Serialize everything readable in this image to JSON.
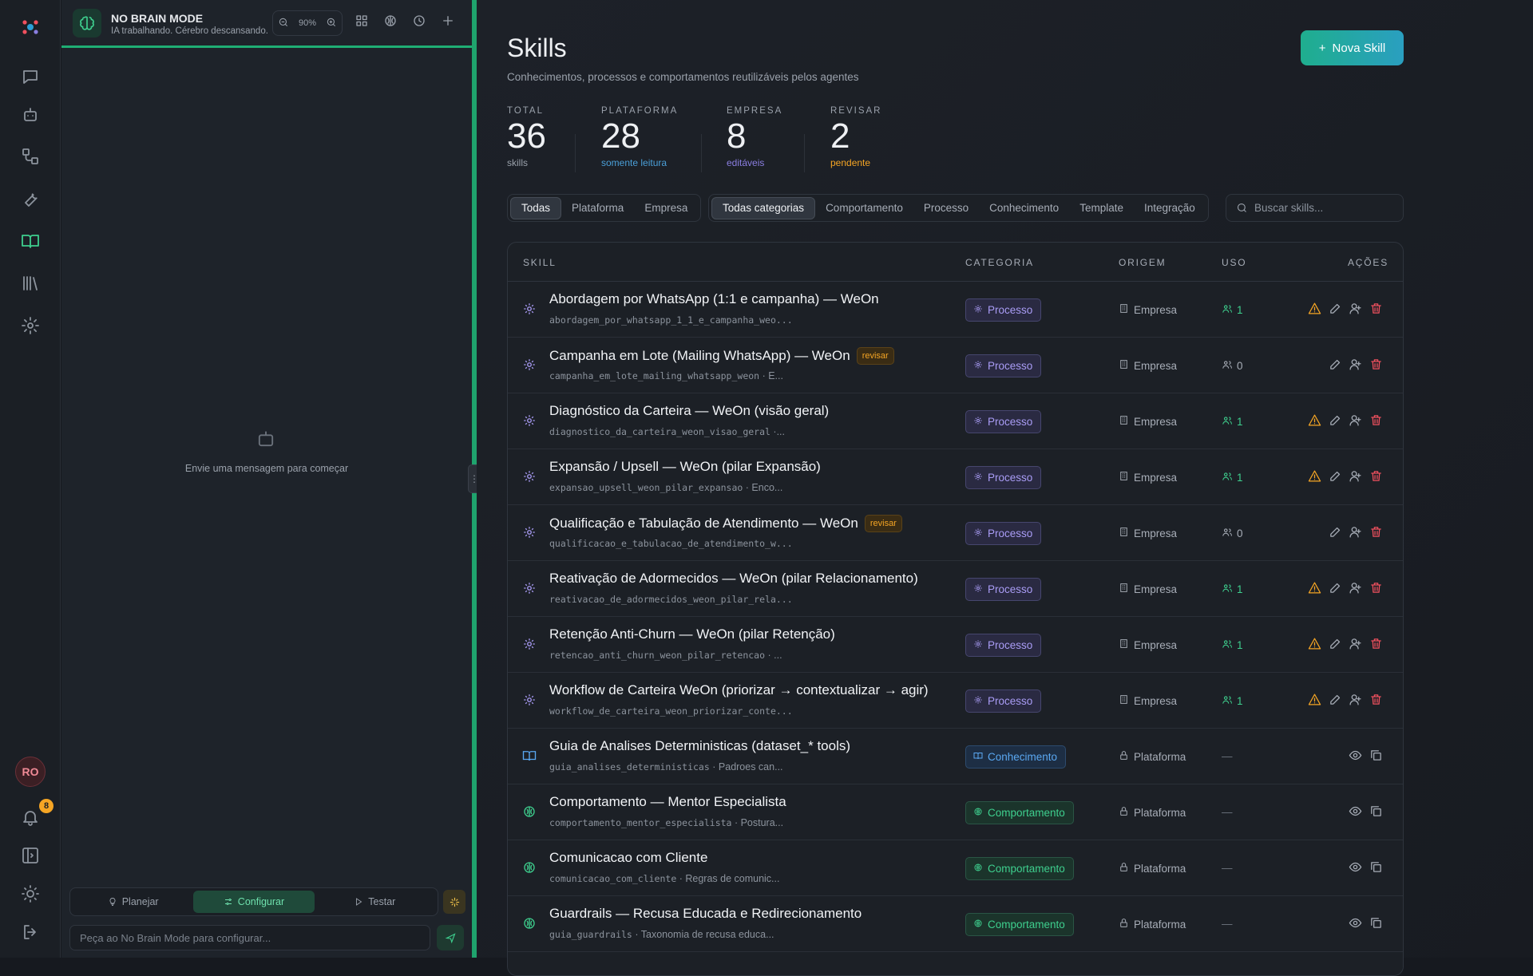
{
  "sidebar": {
    "avatar_initials": "RO",
    "notifications_count": "8",
    "icons": [
      "chat-icon",
      "bot-icon",
      "workflow-icon",
      "wrench-icon",
      "book-icon",
      "library-icon",
      "settings-icon"
    ],
    "bottom_icons": [
      "bell-icon",
      "panel-icon",
      "sun-icon",
      "logout-icon"
    ]
  },
  "chat": {
    "title": "NO BRAIN MODE",
    "subtitle": "IA trabalhando. Cérebro descansando.",
    "zoom": "90%",
    "empty_text": "Envie uma mensagem para começar",
    "modes": [
      "Planejar",
      "Configurar",
      "Testar"
    ],
    "active_mode": "Configurar",
    "input_placeholder": "Peça ao No Brain Mode para configurar..."
  },
  "page": {
    "title": "Skills",
    "subtitle": "Conhecimentos, processos e comportamentos reutilizáveis pelos agentes",
    "new_button": "Nova Skill",
    "accent": "#1fae8e"
  },
  "stats": [
    {
      "label": "TOTAL",
      "value": "36",
      "note": "skills",
      "color": "#9aa1ab"
    },
    {
      "label": "PLATAFORMA",
      "value": "28",
      "note": "somente leitura",
      "color": "#4a9fd8"
    },
    {
      "label": "EMPRESA",
      "value": "8",
      "note": "editáveis",
      "color": "#8a7ee0"
    },
    {
      "label": "REVISAR",
      "value": "2",
      "note": "pendente",
      "color": "#f5a524"
    }
  ],
  "filters": {
    "origin": [
      "Todas",
      "Plataforma",
      "Empresa"
    ],
    "origin_active": "Todas",
    "category": [
      "Todas categorias",
      "Comportamento",
      "Processo",
      "Conhecimento",
      "Template",
      "Integração"
    ],
    "category_active": "Todas categorias",
    "search_placeholder": "Buscar skills..."
  },
  "table": {
    "headers": {
      "skill": "SKILL",
      "categoria": "CATEGORIA",
      "origem": "ORIGEM",
      "uso": "USO",
      "acoes": "AÇÕES"
    },
    "rows": [
      {
        "name": "Abordagem por WhatsApp (1:1 e campanha) — WeOn",
        "slug": "abordagem_por_whatsapp_1_1_e_campanha_weo...",
        "desc": "",
        "category": "Processo",
        "origin": "Empresa",
        "uso": "1",
        "review": ""
      },
      {
        "name": "Campanha em Lote (Mailing WhatsApp) — WeOn",
        "slug": "campanha_em_lote_mailing_whatsapp_weon",
        "desc": " · E...",
        "category": "Processo",
        "origin": "Empresa",
        "uso": "0",
        "review": "revisar"
      },
      {
        "name": "Diagnóstico da Carteira — WeOn (visão geral)",
        "slug": "diagnostico_da_carteira_weon_visao_geral",
        "desc": " ·...",
        "category": "Processo",
        "origin": "Empresa",
        "uso": "1",
        "review": ""
      },
      {
        "name": "Expansão / Upsell — WeOn (pilar Expansão)",
        "slug": "expansao_upsell_weon_pilar_expansao",
        "desc": " · Enco...",
        "category": "Processo",
        "origin": "Empresa",
        "uso": "1",
        "review": ""
      },
      {
        "name": "Qualificação e Tabulação de Atendimento — WeOn",
        "slug": "qualificacao_e_tabulacao_de_atendimento_w...",
        "desc": "",
        "category": "Processo",
        "origin": "Empresa",
        "uso": "0",
        "review": "revisar"
      },
      {
        "name": "Reativação de Adormecidos — WeOn (pilar Relacionamento)",
        "slug": "reativacao_de_adormecidos_weon_pilar_rela...",
        "desc": "",
        "category": "Processo",
        "origin": "Empresa",
        "uso": "1",
        "review": ""
      },
      {
        "name": "Retenção Anti-Churn — WeOn (pilar Retenção)",
        "slug": "retencao_anti_churn_weon_pilar_retencao",
        "desc": " · ...",
        "category": "Processo",
        "origin": "Empresa",
        "uso": "1",
        "review": ""
      },
      {
        "name": "Workflow de Carteira WeOn (priorizar → contextualizar → agir)",
        "slug": "workflow_de_carteira_weon_priorizar_conte...",
        "desc": "",
        "category": "Processo",
        "origin": "Empresa",
        "uso": "1",
        "review": ""
      },
      {
        "name": "Guia de Analises Deterministicas (dataset_* tools)",
        "slug": "guia_analises_deterministicas",
        "desc": " · Padroes can...",
        "category": "Conhecimento",
        "origin": "Plataforma",
        "uso": "—",
        "review": ""
      },
      {
        "name": "Comportamento — Mentor Especialista",
        "slug": "comportamento_mentor_especialista",
        "desc": " · Postura...",
        "category": "Comportamento",
        "origin": "Plataforma",
        "uso": "—",
        "review": ""
      },
      {
        "name": "Comunicacao com Cliente",
        "slug": "comunicacao_com_cliente",
        "desc": " · Regras de comunic...",
        "category": "Comportamento",
        "origin": "Plataforma",
        "uso": "—",
        "review": ""
      },
      {
        "name": "Guardrails — Recusa Educada e Redirecionamento",
        "slug": "guia_guardrails",
        "desc": " · Taxonomia de recusa educa...",
        "category": "Comportamento",
        "origin": "Plataforma",
        "uso": "—",
        "review": ""
      },
      {
        "name": "",
        "slug": "",
        "desc": "",
        "category": "",
        "origin": "",
        "uso": "",
        "review": ""
      }
    ]
  }
}
